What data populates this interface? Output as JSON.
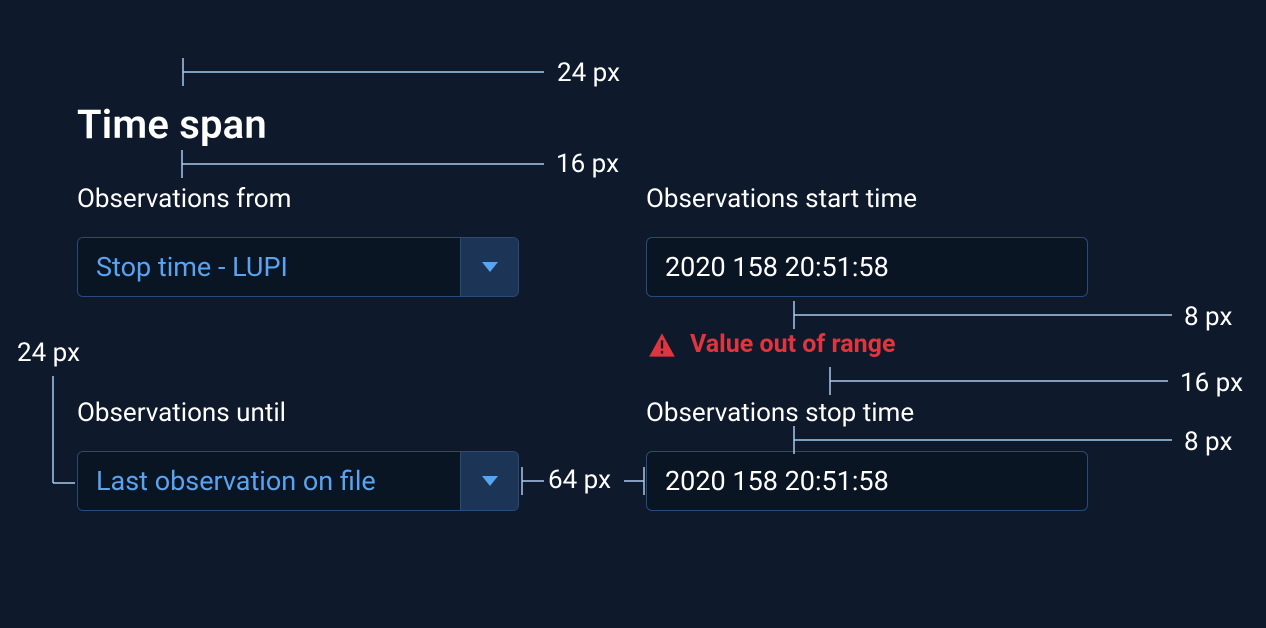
{
  "title": "Time span",
  "fields": {
    "observations_from": {
      "label": "Observations from",
      "value": "Stop time - LUPI"
    },
    "observations_until": {
      "label": "Observations until",
      "value": "Last observation on file"
    },
    "observations_start_time": {
      "label": "Observations start time",
      "value": "2020 158 20:51:58"
    },
    "observations_stop_time": {
      "label": "Observations stop time",
      "value": "2020 158 20:51:58"
    }
  },
  "error": {
    "message": "Value out of range"
  },
  "annotations": {
    "top_24": "24 px",
    "title_16": "16 px",
    "left_24": "24 px",
    "mid_64": "64 px",
    "r1_8": "8 px",
    "r2_16": "16 px",
    "r3_8": "8 px"
  },
  "icons": {
    "warning": "alert-triangle-icon",
    "caret": "chevron-down-icon"
  },
  "colors": {
    "bg": "#0e1a2b",
    "panel": "#0a1524",
    "border": "#2a4a78",
    "accent": "#5aa3f0",
    "text": "#ffffff",
    "error": "#e0353e"
  }
}
